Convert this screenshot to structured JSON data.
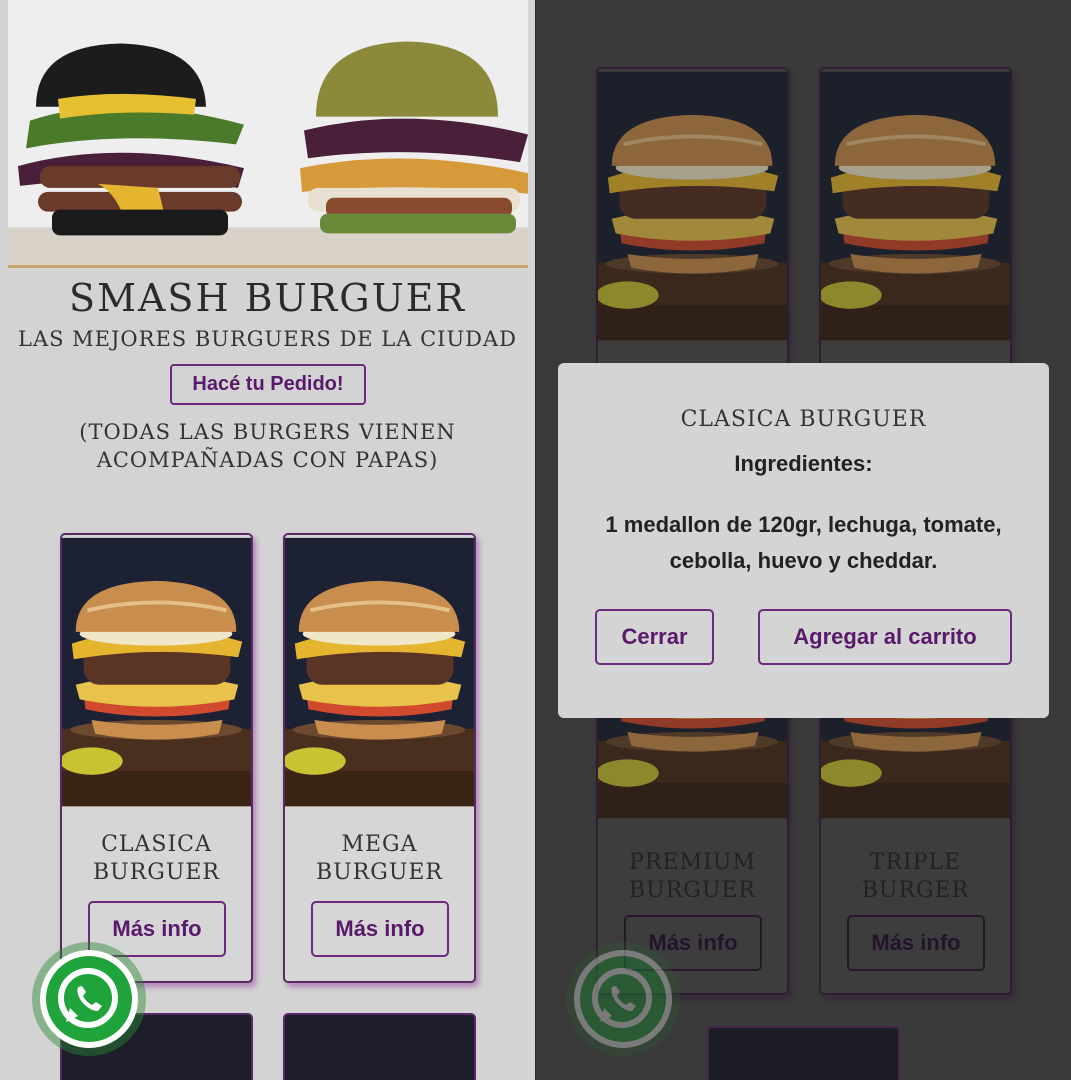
{
  "left_screen": {
    "hero": {
      "image": "two-gourmet-burgers-photo"
    },
    "brand": {
      "title": "SMASH BURGUER",
      "subtitle": "LAS MEJORES BURGUERS DE LA CIUDAD"
    },
    "order_button": "Hacé tu Pedido!",
    "note_line1": "(TODAS LAS BURGERS VIENEN",
    "note_line2": "ACOMPAÑADAS CON PAPAS)",
    "cards": [
      {
        "name_line1": "CLASICA",
        "name_line2": "BURGUER",
        "button": "Más info",
        "image": "burger-photo"
      },
      {
        "name_line1": "MEGA",
        "name_line2": "BURGUER",
        "button": "Más info",
        "image": "burger-photo"
      }
    ],
    "whatsapp_icon": "whatsapp-icon"
  },
  "right_screen": {
    "cards": [
      {
        "name_line1": "PREMIUM",
        "name_line2": "BURGUER",
        "button": "Más info",
        "image": "burger-photo"
      },
      {
        "name_line1": "TRIPLE",
        "name_line2": "BURGER",
        "button": "Más info",
        "image": "burger-photo"
      }
    ],
    "modal": {
      "title": "CLASICA BURGUER",
      "heading": "Ingredientes:",
      "description": "1 medallon de 120gr, lechuga, tomate, cebolla, huevo y cheddar.",
      "close_button": "Cerrar",
      "add_button": "Agregar al carrito"
    },
    "whatsapp_icon": "whatsapp-icon"
  },
  "colors": {
    "accent_purple": "#6b2a7d",
    "button_text": "#5a1a6b",
    "page_bg": "#d3d3d3",
    "overlay_bg": "#4a4a4a",
    "whatsapp_green": "#1fa33a"
  }
}
